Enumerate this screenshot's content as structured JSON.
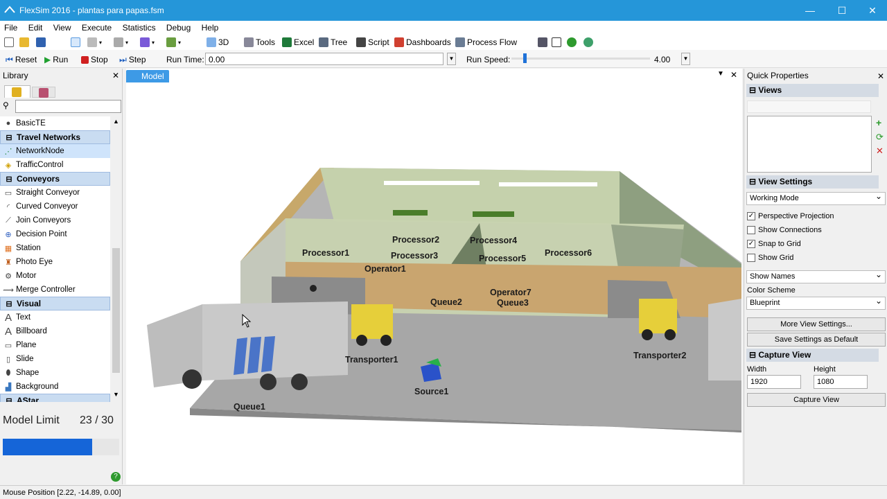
{
  "window": {
    "title": "FlexSim 2016 - plantas para papas.fsm",
    "controls": {
      "minimize": "—",
      "maximize": "☐",
      "close": "✕"
    }
  },
  "menu": [
    "File",
    "Edit",
    "View",
    "Execute",
    "Statistics",
    "Debug",
    "Help"
  ],
  "toolbar": {
    "view3d": "3D",
    "tools": "Tools",
    "excel": "Excel",
    "tree": "Tree",
    "script": "Script",
    "dashboards": "Dashboards",
    "process_flow": "Process Flow"
  },
  "runbar": {
    "reset": "Reset",
    "run": "Run",
    "stop": "Stop",
    "step": "Step",
    "run_time_label": "Run Time:",
    "run_time_value": "0.00",
    "run_speed_label": "Run Speed:",
    "run_speed_value": "4.00",
    "run_speed_fraction": 0.08
  },
  "library": {
    "title": "Library",
    "items": [
      {
        "label": "BasicTE",
        "type": "item",
        "icon": "sphere-icon"
      },
      {
        "label": "Travel Networks",
        "type": "category"
      },
      {
        "label": "NetworkNode",
        "type": "item",
        "icon": "network-node-icon",
        "selected": true
      },
      {
        "label": "TrafficControl",
        "type": "item",
        "icon": "traffic-control-icon"
      },
      {
        "label": "Conveyors",
        "type": "category"
      },
      {
        "label": "Straight Conveyor",
        "type": "item",
        "icon": "conveyor-icon"
      },
      {
        "label": "Curved Conveyor",
        "type": "item",
        "icon": "curved-conveyor-icon"
      },
      {
        "label": "Join Conveyors",
        "type": "item",
        "icon": "join-icon"
      },
      {
        "label": "Decision Point",
        "type": "item",
        "icon": "decision-point-icon"
      },
      {
        "label": "Station",
        "type": "item",
        "icon": "station-icon"
      },
      {
        "label": "Photo Eye",
        "type": "item",
        "icon": "photo-eye-icon"
      },
      {
        "label": "Motor",
        "type": "item",
        "icon": "motor-icon"
      },
      {
        "label": "Merge Controller",
        "type": "item",
        "icon": "merge-icon"
      },
      {
        "label": "Visual",
        "type": "category"
      },
      {
        "label": "Text",
        "type": "item",
        "icon": "text-icon"
      },
      {
        "label": "Billboard",
        "type": "item",
        "icon": "billboard-icon"
      },
      {
        "label": "Plane",
        "type": "item",
        "icon": "plane-icon"
      },
      {
        "label": "Slide",
        "type": "item",
        "icon": "slide-icon"
      },
      {
        "label": "Shape",
        "type": "item",
        "icon": "shape-icon"
      },
      {
        "label": "Background",
        "type": "item",
        "icon": "background-icon"
      },
      {
        "label": "AStar",
        "type": "category"
      }
    ],
    "model_limit_label": "Model Limit",
    "model_limit_value": "23 / 30",
    "model_limit_fraction": 0.77
  },
  "model": {
    "tab": "Model",
    "labels": {
      "processor1": "Processor1",
      "processor2": "Processor2",
      "processor3": "Processor3",
      "processor4": "Processor4",
      "processor5": "Processor5",
      "processor6": "Processor6",
      "operator1": "Operator1",
      "operator7": "Operator7",
      "queue1": "Queue1",
      "queue2": "Queue2",
      "queue3": "Queue3",
      "transporter1": "Transporter1",
      "transporter2": "Transporter2",
      "source1": "Source1"
    }
  },
  "quick": {
    "title": "Quick Properties",
    "views": "Views",
    "view_settings": "View Settings",
    "working_mode": "Working Mode",
    "checks": [
      {
        "label": "Perspective Projection",
        "checked": true
      },
      {
        "label": "Show Connections",
        "checked": false
      },
      {
        "label": "Snap to Grid",
        "checked": true
      },
      {
        "label": "Show Grid",
        "checked": false
      }
    ],
    "show_names": "Show Names",
    "color_scheme_label": "Color Scheme",
    "color_scheme": "Blueprint",
    "more_view_settings": "More View Settings...",
    "save_default": "Save Settings as Default",
    "capture_view": "Capture View",
    "width_label": "Width",
    "height_label": "Height",
    "width": "1920",
    "height": "1080",
    "capture_btn": "Capture View"
  },
  "status": {
    "mouse_position": "Mouse Position [2.22, -14.89, 0.00]"
  }
}
